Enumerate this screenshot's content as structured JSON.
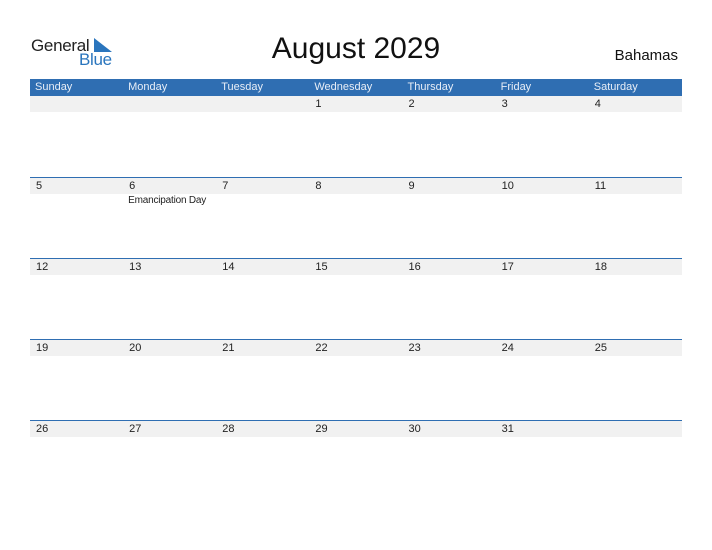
{
  "logo": {
    "line1": "General",
    "line2": "Blue"
  },
  "title": "August 2029",
  "country": "Bahamas",
  "colors": {
    "header_bg": "#2f6eb2",
    "date_strip": "#f1f1f1",
    "brand_blue": "#2a75bd"
  },
  "weekdays": [
    "Sunday",
    "Monday",
    "Tuesday",
    "Wednesday",
    "Thursday",
    "Friday",
    "Saturday"
  ],
  "weeks": [
    {
      "dates": [
        "",
        "",
        "",
        "1",
        "2",
        "3",
        "4"
      ],
      "events": [
        "",
        "",
        "",
        "",
        "",
        "",
        ""
      ]
    },
    {
      "dates": [
        "5",
        "6",
        "7",
        "8",
        "9",
        "10",
        "11"
      ],
      "events": [
        "",
        "Emancipation Day",
        "",
        "",
        "",
        "",
        ""
      ]
    },
    {
      "dates": [
        "12",
        "13",
        "14",
        "15",
        "16",
        "17",
        "18"
      ],
      "events": [
        "",
        "",
        "",
        "",
        "",
        "",
        ""
      ]
    },
    {
      "dates": [
        "19",
        "20",
        "21",
        "22",
        "23",
        "24",
        "25"
      ],
      "events": [
        "",
        "",
        "",
        "",
        "",
        "",
        ""
      ]
    },
    {
      "dates": [
        "26",
        "27",
        "28",
        "29",
        "30",
        "31",
        ""
      ],
      "events": [
        "",
        "",
        "",
        "",
        "",
        "",
        ""
      ]
    }
  ]
}
